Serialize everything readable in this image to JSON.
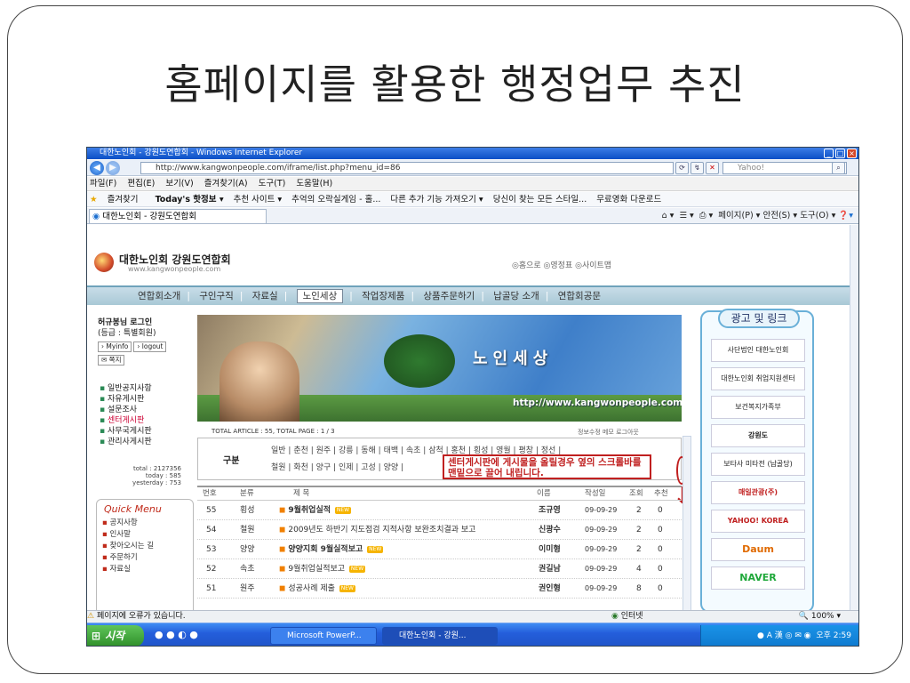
{
  "slide": {
    "title": "홈페이지를 활용한 행정업무 추진"
  },
  "window": {
    "title": "대한노인회 - 강원도연합회 - Windows Internet Explorer",
    "address": "http://www.kangwonpeople.com/iframe/list.php?menu_id=86",
    "address_domain": "kangwonpeople.com",
    "search_placeholder": "Yahoo!",
    "menu": [
      "파일(F)",
      "편집(E)",
      "보기(V)",
      "즐겨찾기(A)",
      "도구(T)",
      "도움말(H)"
    ],
    "favorites": [
      "즐겨찾기",
      "Today's 핫정보 ▾",
      "추천 사이트 ▾",
      "추억의 오락실게임 - 홀...",
      "다른 추가 기능 가져오기 ▾",
      "당신이 찾는 모든 스타일...",
      "무료영화 다운로드"
    ],
    "tab": "대한노인회 - 강원도연합회",
    "commands": "페이지(P) ▾  안전(S) ▾  도구(O) ▾",
    "status_left": "페이지에 오류가 있습니다.",
    "status_zone": "인터넷",
    "zoom": "100%"
  },
  "site": {
    "org_name": "대한노인회 강원도연합회",
    "org_url": "www.kangwonpeople.com",
    "top_links": "◎홈으로  ◎영정표  ◎사이트맵",
    "nav": [
      "연합회소개",
      "구인구직",
      "자료실",
      "노인세상",
      "작업장제품",
      "상품주문하기",
      "납골당 소개",
      "연합회공문"
    ],
    "active_nav": "노인세상",
    "user_name": "허규봉님 로그인",
    "user_grade": "(등급 : 특별회원)",
    "myinfo": "Myinfo",
    "logout": "logout",
    "note": "쪽지",
    "boards": [
      "일반공지사항",
      "자유게시판",
      "설문조사",
      "센터게시판",
      "사무국게시판",
      "관리사게시판"
    ],
    "counter": [
      "total : 2127356",
      "today : 585",
      "yesterday : 753"
    ],
    "quick_title": "Quick Menu",
    "quick_items": [
      "공지사항",
      "인사말",
      "찾아오시는 길",
      "주문하기",
      "자료실"
    ],
    "banner_title": "노인세상",
    "banner_url": "http://www.kangwonpeople.com",
    "article_info": "TOTAL ARTICLE : 55, TOTAL PAGE : 1 / 3",
    "article_tools": "정보수정  메모  로그아웃",
    "category_label": "구분",
    "categories_1": "일반 | 춘천 | 원주 | 강릉 | 동해 | 태백 | 속초 | 삼척 | 홍천 | 횡성 | 영월 | 평창 | 정선 |",
    "categories_2": "철원 | 화천 | 양구 | 인제 | 고성 | 양양 |",
    "callout": "센터게시판에 게시물을 올릴경우 옆의 스크롤바를 맨밑으로 끌어 내립니다.",
    "table_headers": {
      "no": "번호",
      "cat": "분류",
      "title": "제 목",
      "name": "이름",
      "date": "작성일",
      "views": "조회",
      "rec": "추천"
    },
    "rows": [
      {
        "no": "55",
        "cat": "횡성",
        "title": "9월취업실적",
        "name": "조규영",
        "date": "09-09-29",
        "views": "2",
        "rec": "0"
      },
      {
        "no": "54",
        "cat": "철원",
        "title": "2009년도 하반기 지도점검 지적사항 보완조치결과 보고",
        "name": "신광수",
        "date": "09-09-29",
        "views": "2",
        "rec": "0"
      },
      {
        "no": "53",
        "cat": "양양",
        "title": "양양지회 9월실적보고",
        "name": "이미형",
        "date": "09-09-29",
        "views": "2",
        "rec": "0"
      },
      {
        "no": "52",
        "cat": "속초",
        "title": "9월취업실적보고",
        "name": "권길남",
        "date": "09-09-29",
        "views": "4",
        "rec": "0"
      },
      {
        "no": "51",
        "cat": "원주",
        "title": "성공사례 제출",
        "name": "권인형",
        "date": "09-09-29",
        "views": "8",
        "rec": "0"
      }
    ],
    "new_badge": "NEW",
    "ad_title": "광고 및 링크",
    "ads": [
      "사단법인 대한노인회",
      "대한노인회 취업지원센터",
      "보건복지가족부",
      "강원도",
      "보타사 미타전 (납골당)",
      "매일관광(주)",
      "YAHOO! KOREA",
      "Daum",
      "NAVER"
    ]
  },
  "taskbar": {
    "start": "시작",
    "items": [
      "Microsoft PowerP...",
      "대한노인회 - 강원..."
    ],
    "clock": "오후 2:59"
  }
}
